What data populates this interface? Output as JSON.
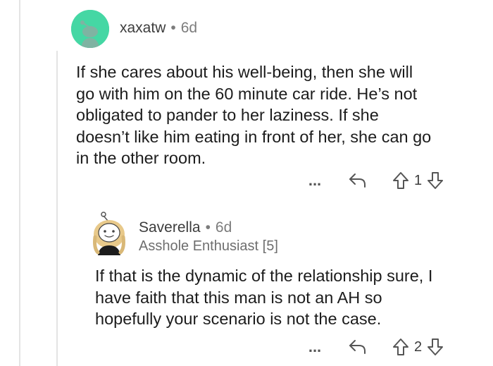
{
  "comments": [
    {
      "username": "xaxatw",
      "age": "6d",
      "body_lines": [
        "If she cares about his well-being, then she will",
        "go with him on the 60 minute car ride. He’s not",
        "obligated to pander to her laziness. If she",
        "doesn’t like him eating in front of her, she can go",
        "in the other room."
      ],
      "score": "1",
      "avatar_color": "#45d7a4"
    },
    {
      "username": "Saverella",
      "age": "6d",
      "flair": "Asshole Enthusiast [5]",
      "body_lines": [
        "If that is the dynamic of the relationship sure, I",
        "have faith that this man is not an AH so",
        "hopefully your scenario is not the case."
      ],
      "score": "2"
    }
  ],
  "separator": "•",
  "more_label": "..."
}
